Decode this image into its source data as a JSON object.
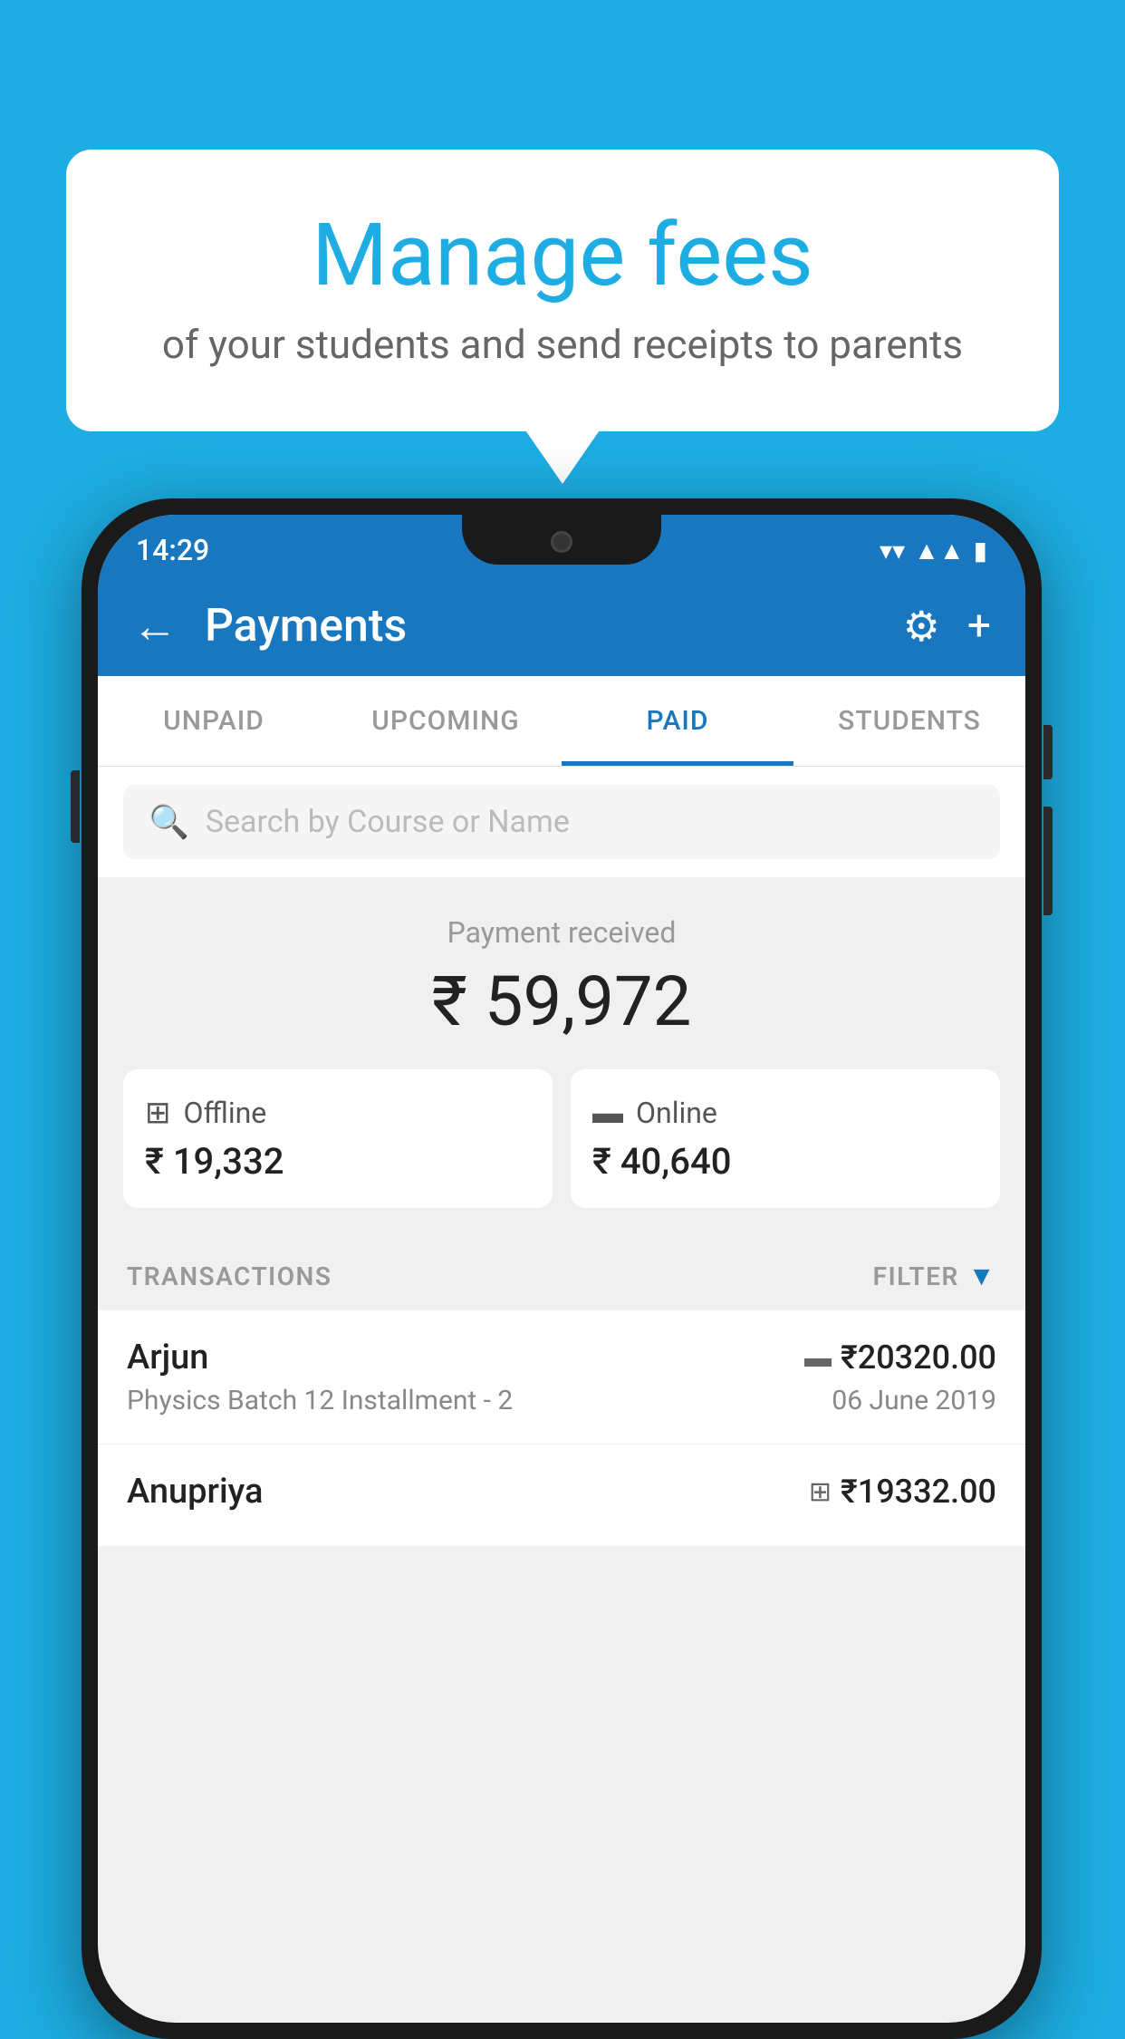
{
  "page": {
    "background_color": "#1DADE2"
  },
  "speech_bubble": {
    "title": "Manage fees",
    "subtitle": "of your students and send receipts to parents"
  },
  "phone": {
    "status_bar": {
      "time": "14:29",
      "wifi_icon": "▼",
      "signal_icon": "▲",
      "battery_icon": "▮"
    },
    "header": {
      "back_label": "←",
      "title": "Payments",
      "gear_icon": "⚙",
      "plus_icon": "+"
    },
    "tabs": [
      {
        "label": "UNPAID",
        "active": false
      },
      {
        "label": "UPCOMING",
        "active": false
      },
      {
        "label": "PAID",
        "active": true
      },
      {
        "label": "STUDENTS",
        "active": false
      }
    ],
    "search": {
      "placeholder": "Search by Course or Name"
    },
    "payment_summary": {
      "label": "Payment received",
      "total_amount": "₹ 59,972",
      "offline": {
        "label": "Offline",
        "amount": "₹ 19,332"
      },
      "online": {
        "label": "Online",
        "amount": "₹ 40,640"
      }
    },
    "transactions_section": {
      "label": "TRANSACTIONS",
      "filter_label": "FILTER"
    },
    "transactions": [
      {
        "name": "Arjun",
        "amount": "₹20320.00",
        "course": "Physics Batch 12 Installment - 2",
        "date": "06 June 2019",
        "payment_type": "card"
      },
      {
        "name": "Anupriya",
        "amount": "₹19332.00",
        "course": "",
        "date": "",
        "payment_type": "offline"
      }
    ]
  }
}
